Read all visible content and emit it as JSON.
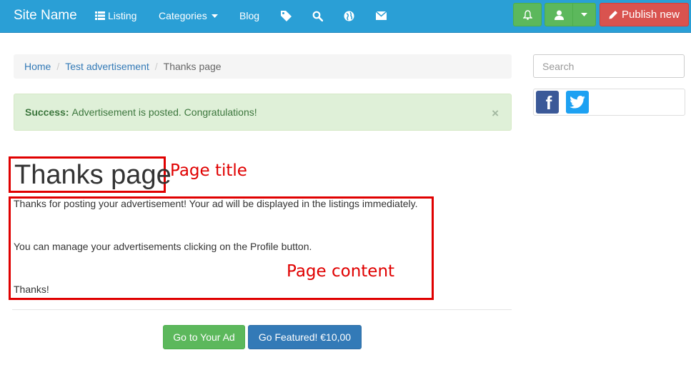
{
  "navbar": {
    "brand": "Site Name",
    "listing": "Listing",
    "categories": "Categories",
    "blog": "Blog",
    "publish": "Publish new",
    "icons": [
      "list-icon",
      "tag-icon",
      "search-icon",
      "globe-icon",
      "envelope-icon",
      "bell-icon",
      "user-icon",
      "caret-down-icon",
      "pencil-icon"
    ]
  },
  "breadcrumb": {
    "home": "Home",
    "sep1": "/",
    "test": "Test advertisement",
    "sep2": "/",
    "current": "Thanks page"
  },
  "alert": {
    "strong": "Success:",
    "message": "Advertisement is posted. Congratulations!",
    "close": "×"
  },
  "page": {
    "title": "Thanks page",
    "p1": "Thanks for posting your advertisement! Your ad will be displayed in the listings immediately.",
    "p2": "You can manage your advertisements clicking on the Profile button.",
    "p3": "Thanks!"
  },
  "annotations": {
    "title": "Page title",
    "content": "Page content"
  },
  "buttons": {
    "go_to_ad": "Go to Your Ad",
    "featured": "Go Featured! €10,00"
  },
  "sidebar": {
    "search_placeholder": "Search",
    "facebook": "f"
  },
  "colors": {
    "navbar": "#2a9fd6",
    "success": "#5cb85c",
    "danger": "#d9534f",
    "primary": "#337ab7",
    "annotation": "#e00000",
    "facebook": "#3b5998",
    "twitter": "#1da1f2"
  }
}
